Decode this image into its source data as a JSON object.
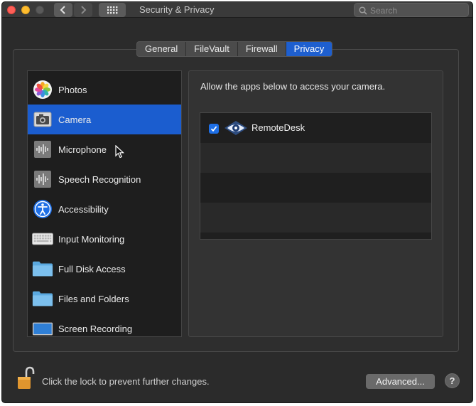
{
  "window": {
    "title": "Security & Privacy",
    "search_placeholder": "Search"
  },
  "tabs": [
    {
      "label": "General",
      "active": false
    },
    {
      "label": "FileVault",
      "active": false
    },
    {
      "label": "Firewall",
      "active": false
    },
    {
      "label": "Privacy",
      "active": true
    }
  ],
  "sidebar": {
    "items": [
      {
        "label": "Photos",
        "icon": "photos-icon",
        "selected": false
      },
      {
        "label": "Camera",
        "icon": "camera-icon",
        "selected": true
      },
      {
        "label": "Microphone",
        "icon": "microphone-icon",
        "selected": false
      },
      {
        "label": "Speech Recognition",
        "icon": "speech-recognition-icon",
        "selected": false
      },
      {
        "label": "Accessibility",
        "icon": "accessibility-icon",
        "selected": false
      },
      {
        "label": "Input Monitoring",
        "icon": "keyboard-icon",
        "selected": false
      },
      {
        "label": "Full Disk Access",
        "icon": "folder-icon",
        "selected": false
      },
      {
        "label": "Files and Folders",
        "icon": "folder-icon",
        "selected": false
      },
      {
        "label": "Screen Recording",
        "icon": "screen-icon",
        "selected": false
      }
    ]
  },
  "panel": {
    "description": "Allow the apps below to access your camera.",
    "apps": [
      {
        "name": "RemoteDesk",
        "checked": true,
        "icon": "eye-icon"
      }
    ]
  },
  "footer": {
    "lock_text": "Click the lock to prevent further changes.",
    "advanced_label": "Advanced...",
    "help_label": "?"
  },
  "colors": {
    "accent": "#1b5dcf",
    "window_bg": "#2b2b2b",
    "list_bg": "#1e1e1e"
  }
}
